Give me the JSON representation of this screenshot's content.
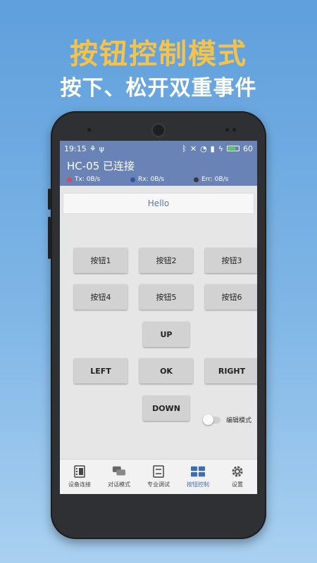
{
  "promo": {
    "headline": "按钮控制模式",
    "subline": "按下、松开双重事件"
  },
  "status_bar": {
    "time": "19:15",
    "battery_level": "60",
    "colors": {
      "bar": "#6a83b6",
      "battery": "#52d64a"
    }
  },
  "app_bar": {
    "title": "HC-05 已连接",
    "tx": {
      "label": "Tx: 0B/s",
      "color": "#e2455a"
    },
    "rx": {
      "label": "Rx: 0B/s",
      "color": "#2e56a6"
    },
    "err": {
      "label": "Err: 0B/s",
      "color": "#3a3a3a"
    }
  },
  "message_box": {
    "text": "Hello"
  },
  "buttons": {
    "b1": "按钮1",
    "b2": "按钮2",
    "b3": "按钮3",
    "b4": "按钮4",
    "b5": "按钮5",
    "b6": "按钮6",
    "up": "UP",
    "left": "LEFT",
    "ok": "OK",
    "right": "RIGHT",
    "down": "DOWN"
  },
  "edit_mode": {
    "label": "编辑模式",
    "enabled": false
  },
  "bottom_nav": {
    "active": "button-control",
    "items": [
      {
        "label": "设备连接",
        "icon": "device-connect-icon"
      },
      {
        "label": "对话模式",
        "icon": "chat-icon"
      },
      {
        "label": "专业调试",
        "icon": "debug-icon"
      },
      {
        "label": "按钮控制",
        "icon": "button-grid-icon"
      },
      {
        "label": "设置",
        "icon": "gear-icon"
      }
    ],
    "accent": "#3d6fb0"
  }
}
